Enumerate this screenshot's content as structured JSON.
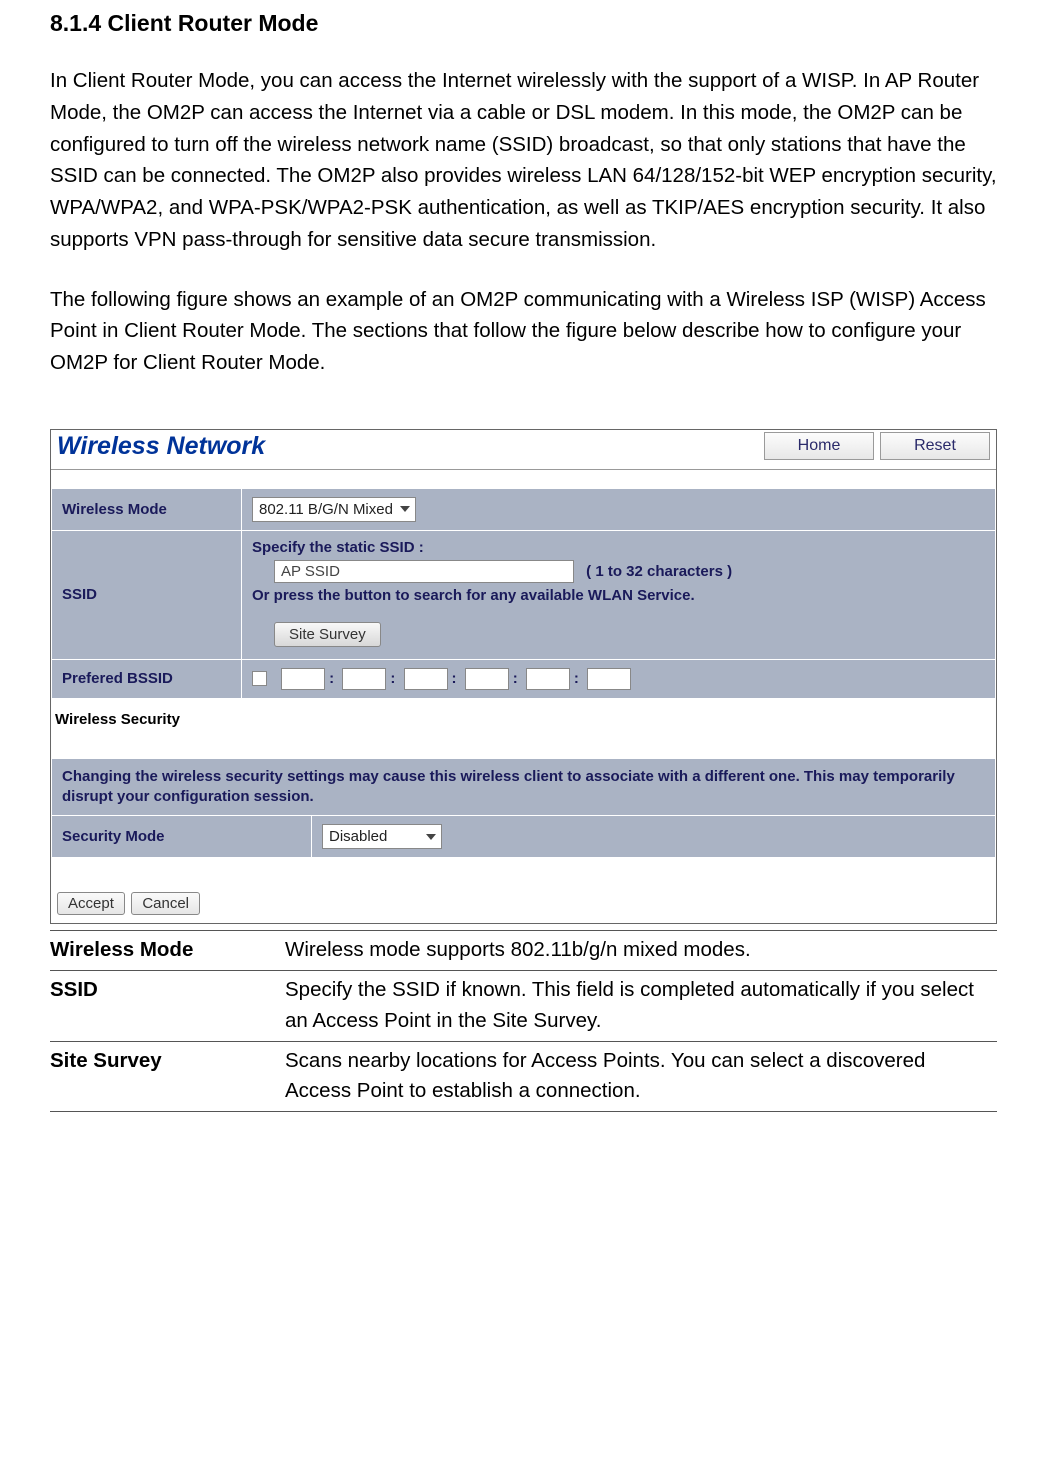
{
  "heading": "8.1.4 Client Router Mode",
  "para1": "In Client Router Mode, you can access the Internet wirelessly with the support of a WISP. In AP Router Mode, the OM2P can access the Internet via a cable or DSL modem. In this mode, the OM2P can be configured to turn off the wireless network name (SSID) broadcast, so that only stations that have the SSID can be connected. The OM2P also provides wireless LAN 64/128/152-bit WEP encryption security, WPA/WPA2, and WPA-PSK/WPA2-PSK authentication, as well as TKIP/AES encryption security. It also supports VPN pass-through for sensitive data secure transmission.",
  "para2": "The following figure shows an example of an OM2P communicating with a Wireless ISP (WISP) Access Point in Client Router Mode. The sections that follow the figure below describe how to configure your OM2P for Client Router Mode.",
  "panel": {
    "title": "Wireless Network",
    "home_btn": "Home",
    "reset_btn": "Reset",
    "rows": {
      "wireless_mode_label": "Wireless Mode",
      "wireless_mode_value": "802.11 B/G/N Mixed",
      "ssid_label": "SSID",
      "ssid_line1": "Specify the static SSID  :",
      "ssid_input": "AP SSID",
      "ssid_hint": "( 1 to 32 characters )",
      "ssid_line2": "Or press the button to search for any available WLAN Service.",
      "site_survey_btn": "Site Survey",
      "bssid_label": "Prefered BSSID",
      "sec_subhead": "Wireless Security",
      "warn": "Changing the wireless security settings may cause this wireless client to associate with a different one. This may temporarily disrupt your configuration session.",
      "secmode_label": "Security Mode",
      "secmode_value": "Disabled"
    },
    "accept_btn": "Accept",
    "cancel_btn": "Cancel"
  },
  "desc": {
    "r1t": "Wireless Mode",
    "r1d": "Wireless mode supports 802.11b/g/n mixed modes.",
    "r2t": "SSID",
    "r2d": "Specify the SSID if known. This field is completed automatically if you select an Access Point in the Site Survey.",
    "r3t": "Site Survey",
    "r3d": "Scans nearby locations for Access Points. You can select a discovered Access Point to establish a connection."
  }
}
